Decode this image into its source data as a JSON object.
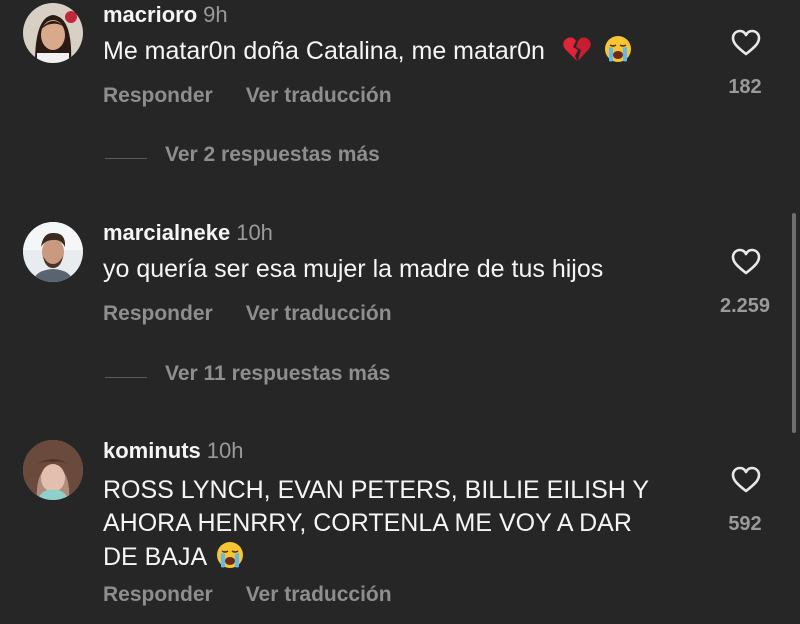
{
  "comments": [
    {
      "username": "macrioro",
      "time": "9h",
      "text": "Me matar0n doña Catalina, me matar0n",
      "emojis": [
        "broken-heart",
        "loudly-crying-face"
      ],
      "likes": "182",
      "reply_label": "Responder",
      "translate_label": "Ver traducción",
      "more_replies": "Ver 2 respuestas más"
    },
    {
      "username": "marcialneke",
      "time": "10h",
      "text": "yo quería ser esa mujer la madre de tus hijos",
      "emojis": [],
      "likes": "2.259",
      "reply_label": "Responder",
      "translate_label": "Ver traducción",
      "more_replies": "Ver 11 respuestas más"
    },
    {
      "username": "kominuts",
      "time": "10h",
      "text_lines": [
        "ROSS LYNCH, EVAN PETERS, BILLIE EILISH Y",
        "AHORA HENRRY, CORTENLA ME VOY A DAR",
        "DE BAJA"
      ],
      "emojis": [
        "loudly-crying-face"
      ],
      "likes": "592",
      "reply_label": "Responder",
      "translate_label": "Ver traducción"
    }
  ],
  "colors": {
    "background": "#262626",
    "primary_text": "#f5f5f5",
    "secondary_text": "#8e8e8e"
  }
}
